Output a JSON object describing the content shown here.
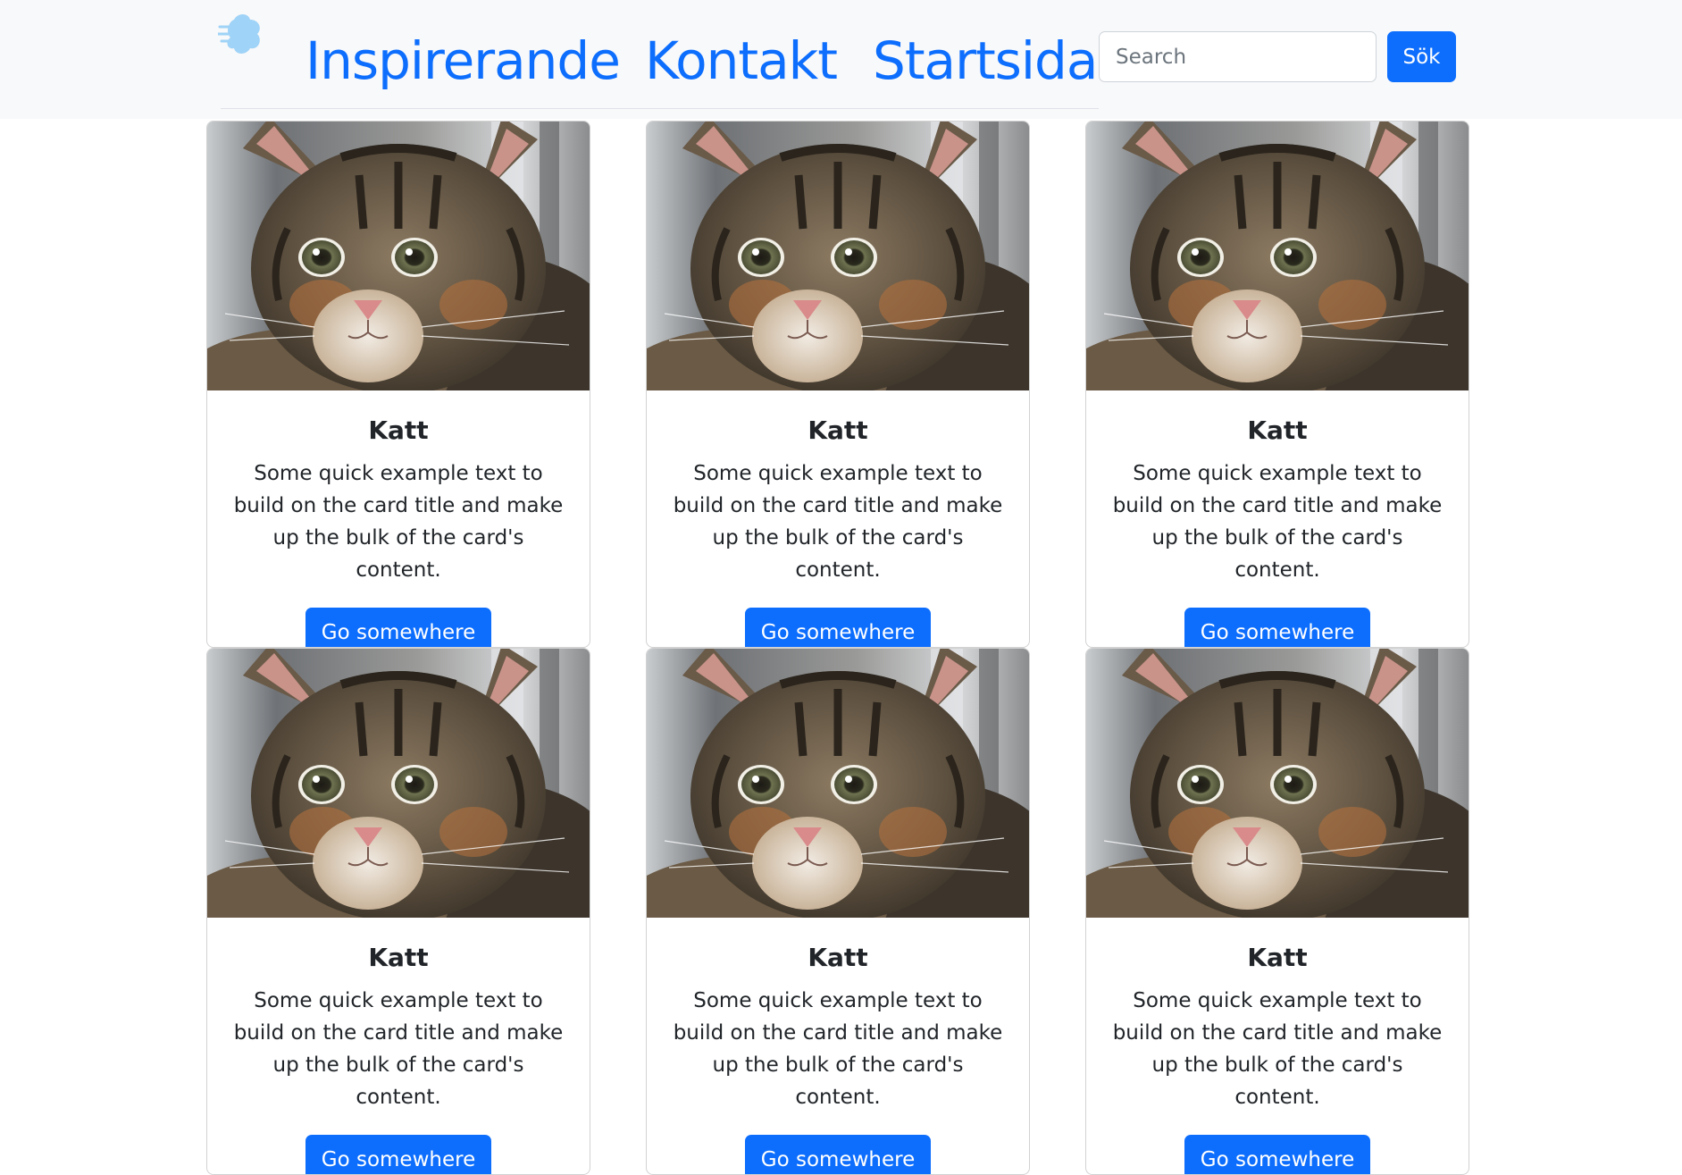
{
  "nav": {
    "links": [
      "Inspirerande",
      "Kontakt",
      "Startsida"
    ],
    "search_placeholder": "Search",
    "search_button": "Sök",
    "logo_icon": "cloud-logo-icon"
  },
  "cards": [
    {
      "title": "Katt",
      "text": "Some quick example text to build on the card title and make up the bulk of the card's content.",
      "button": "Go somewhere",
      "image": "kitten-photo"
    },
    {
      "title": "Katt",
      "text": "Some quick example text to build on the card title and make up the bulk of the card's content.",
      "button": "Go somewhere",
      "image": "kitten-photo"
    },
    {
      "title": "Katt",
      "text": "Some quick example text to build on the card title and make up the bulk of the card's content.",
      "button": "Go somewhere",
      "image": "kitten-photo"
    },
    {
      "title": "Katt",
      "text": "Some quick example text to build on the card title and make up the bulk of the card's content.",
      "button": "Go somewhere",
      "image": "kitten-photo"
    },
    {
      "title": "Katt",
      "text": "Some quick example text to build on the card title and make up the bulk of the card's content.",
      "button": "Go somewhere",
      "image": "kitten-photo"
    },
    {
      "title": "Katt",
      "text": "Some quick example text to build on the card title and make up the bulk of the card's content.",
      "button": "Go somewhere",
      "image": "kitten-photo"
    }
  ],
  "colors": {
    "primary": "#0d6efd",
    "navbar_bg": "#f8f9fa"
  }
}
